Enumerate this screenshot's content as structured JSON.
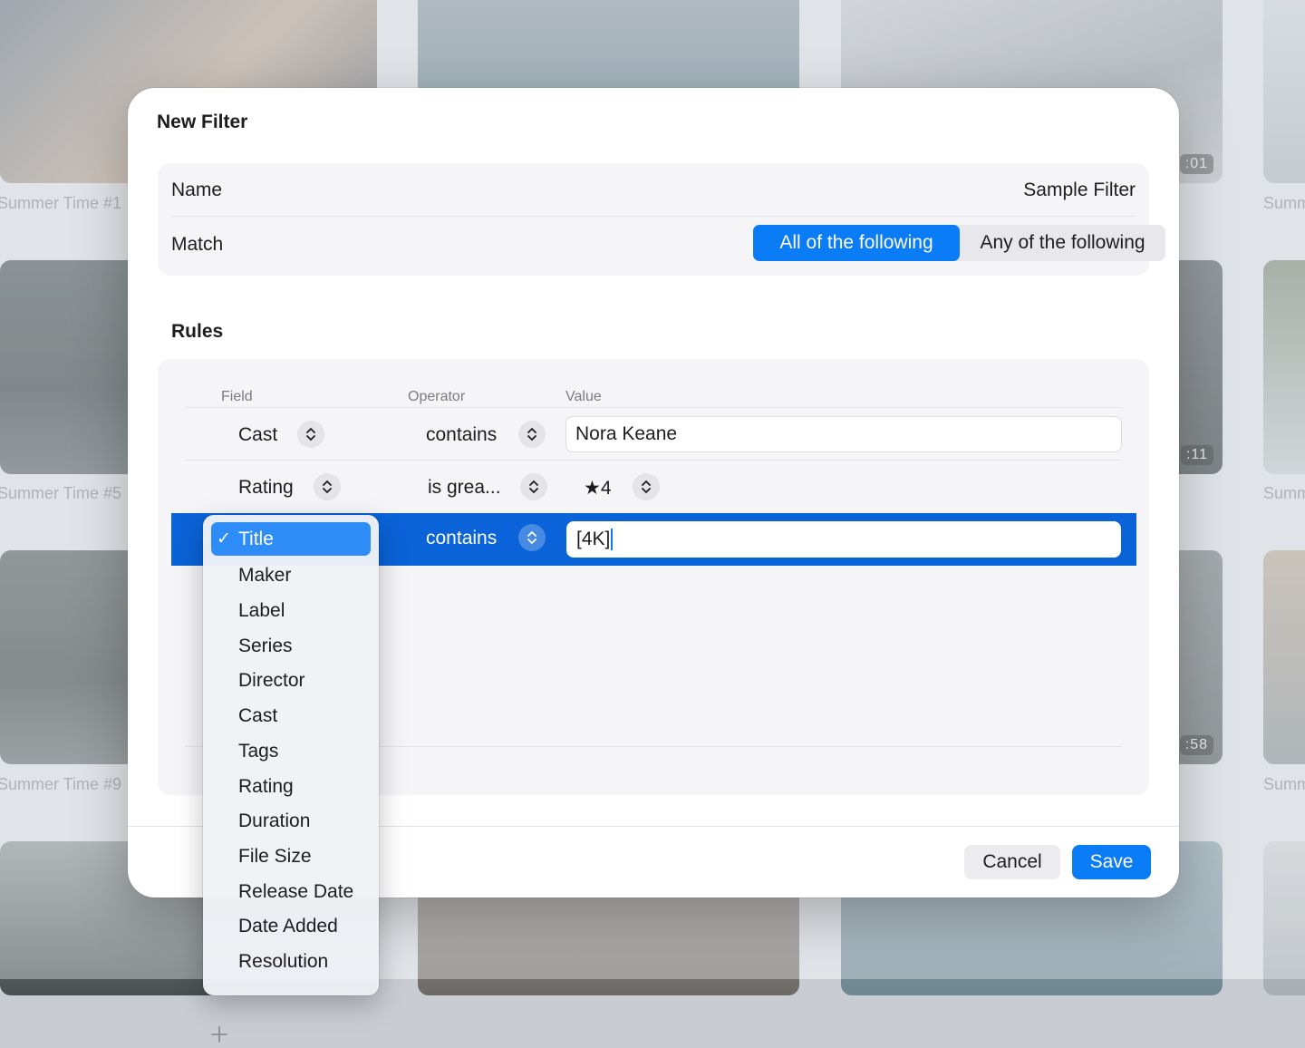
{
  "background": {
    "captions": [
      "Summer Time #1",
      "Summer Time #5",
      "Summer Time #9",
      "Summ",
      "Summ",
      "Summ"
    ],
    "durations": [
      ":01",
      ":11",
      ":58"
    ]
  },
  "modal": {
    "title": "New Filter",
    "name_label": "Name",
    "name_value": "Sample Filter",
    "match_label": "Match",
    "match_options": [
      "All of the following",
      "Any of the following"
    ],
    "match_selected": "All of the following",
    "rules_title": "Rules",
    "columns": {
      "field": "Field",
      "operator": "Operator",
      "value": "Value"
    },
    "rules": [
      {
        "field": "Cast",
        "operator": "contains",
        "value": "Nora Keane"
      },
      {
        "field": "Rating",
        "operator": "is grea...",
        "value": "★4"
      },
      {
        "field": "Title",
        "operator": "contains",
        "value": "[4K]"
      }
    ],
    "cancel_label": "Cancel",
    "save_label": "Save"
  },
  "field_menu": {
    "selected": "Title",
    "check_glyph": "✓",
    "items": [
      "Title",
      "Maker",
      "Label",
      "Series",
      "Director",
      "Cast",
      "Tags",
      "Rating",
      "Duration",
      "File Size",
      "Release Date",
      "Date Added",
      "Resolution"
    ]
  },
  "colors": {
    "accent": "#0a7cf5",
    "selected_row": "#0a63d8"
  },
  "icons": {
    "stepper": "chevron-up-down-icon",
    "add": "plus-icon",
    "check": "checkmark-icon"
  }
}
